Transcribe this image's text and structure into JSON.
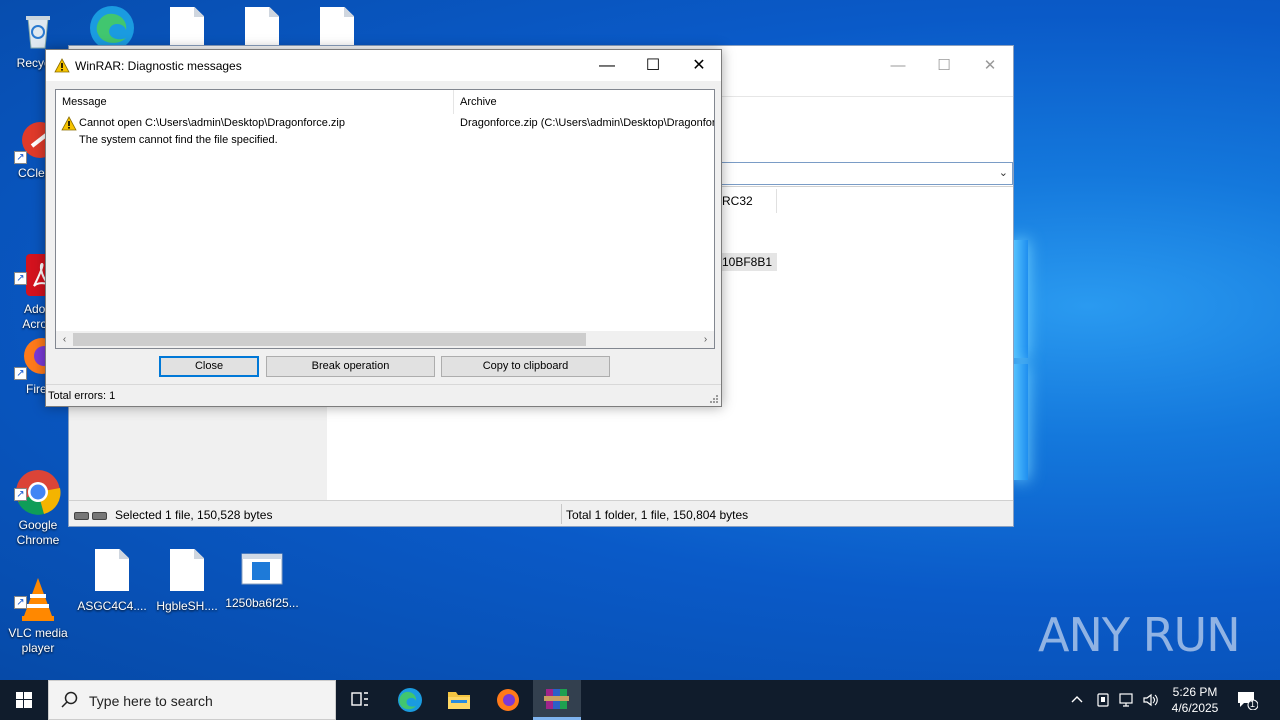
{
  "desktop": {
    "icons": [
      {
        "label": "Recycle"
      },
      {
        "label": "CClean"
      },
      {
        "label": "Adob\nAcrob"
      },
      {
        "label": "Firef"
      },
      {
        "label": "Google\nChrome"
      },
      {
        "label": "VLC media\nplayer"
      },
      {
        "label": "ASGC4C4...."
      },
      {
        "label": "HgbleSH...."
      },
      {
        "label": "1250ba6f25..."
      }
    ],
    "watermark": "ANY RUN"
  },
  "background_window": {
    "column_crc": "RC32",
    "crc_value": "10BF8B1",
    "controls": {
      "minimize": "—",
      "maximize": "☐",
      "close": "✕"
    },
    "status": {
      "left": "Selected 1 file, 150,528 bytes",
      "right": "Total 1 folder, 1 file, 150,804 bytes"
    }
  },
  "dialog": {
    "title": "WinRAR: Diagnostic messages",
    "controls": {
      "minimize": "—",
      "maximize": "☐",
      "close": "✕"
    },
    "columns": {
      "message": "Message",
      "archive": "Archive"
    },
    "messages": [
      {
        "line1": "Cannot open C:\\Users\\admin\\Desktop\\Dragonforce.zip",
        "line2": "The system cannot find the file specified.",
        "archive": "Dragonforce.zip (C:\\Users\\admin\\Desktop\\Dragonfor"
      }
    ],
    "buttons": {
      "close": "Close",
      "break": "Break operation",
      "copy": "Copy to clipboard"
    },
    "status": "Total errors: 1"
  },
  "taskbar": {
    "search_placeholder": "Type here to search",
    "time": "5:26 PM",
    "date": "4/6/2025",
    "notification_count": "1"
  },
  "colors": {
    "accent": "#0078d7",
    "taskbar": "#101c2c",
    "desktop": "#0a5ac8"
  }
}
